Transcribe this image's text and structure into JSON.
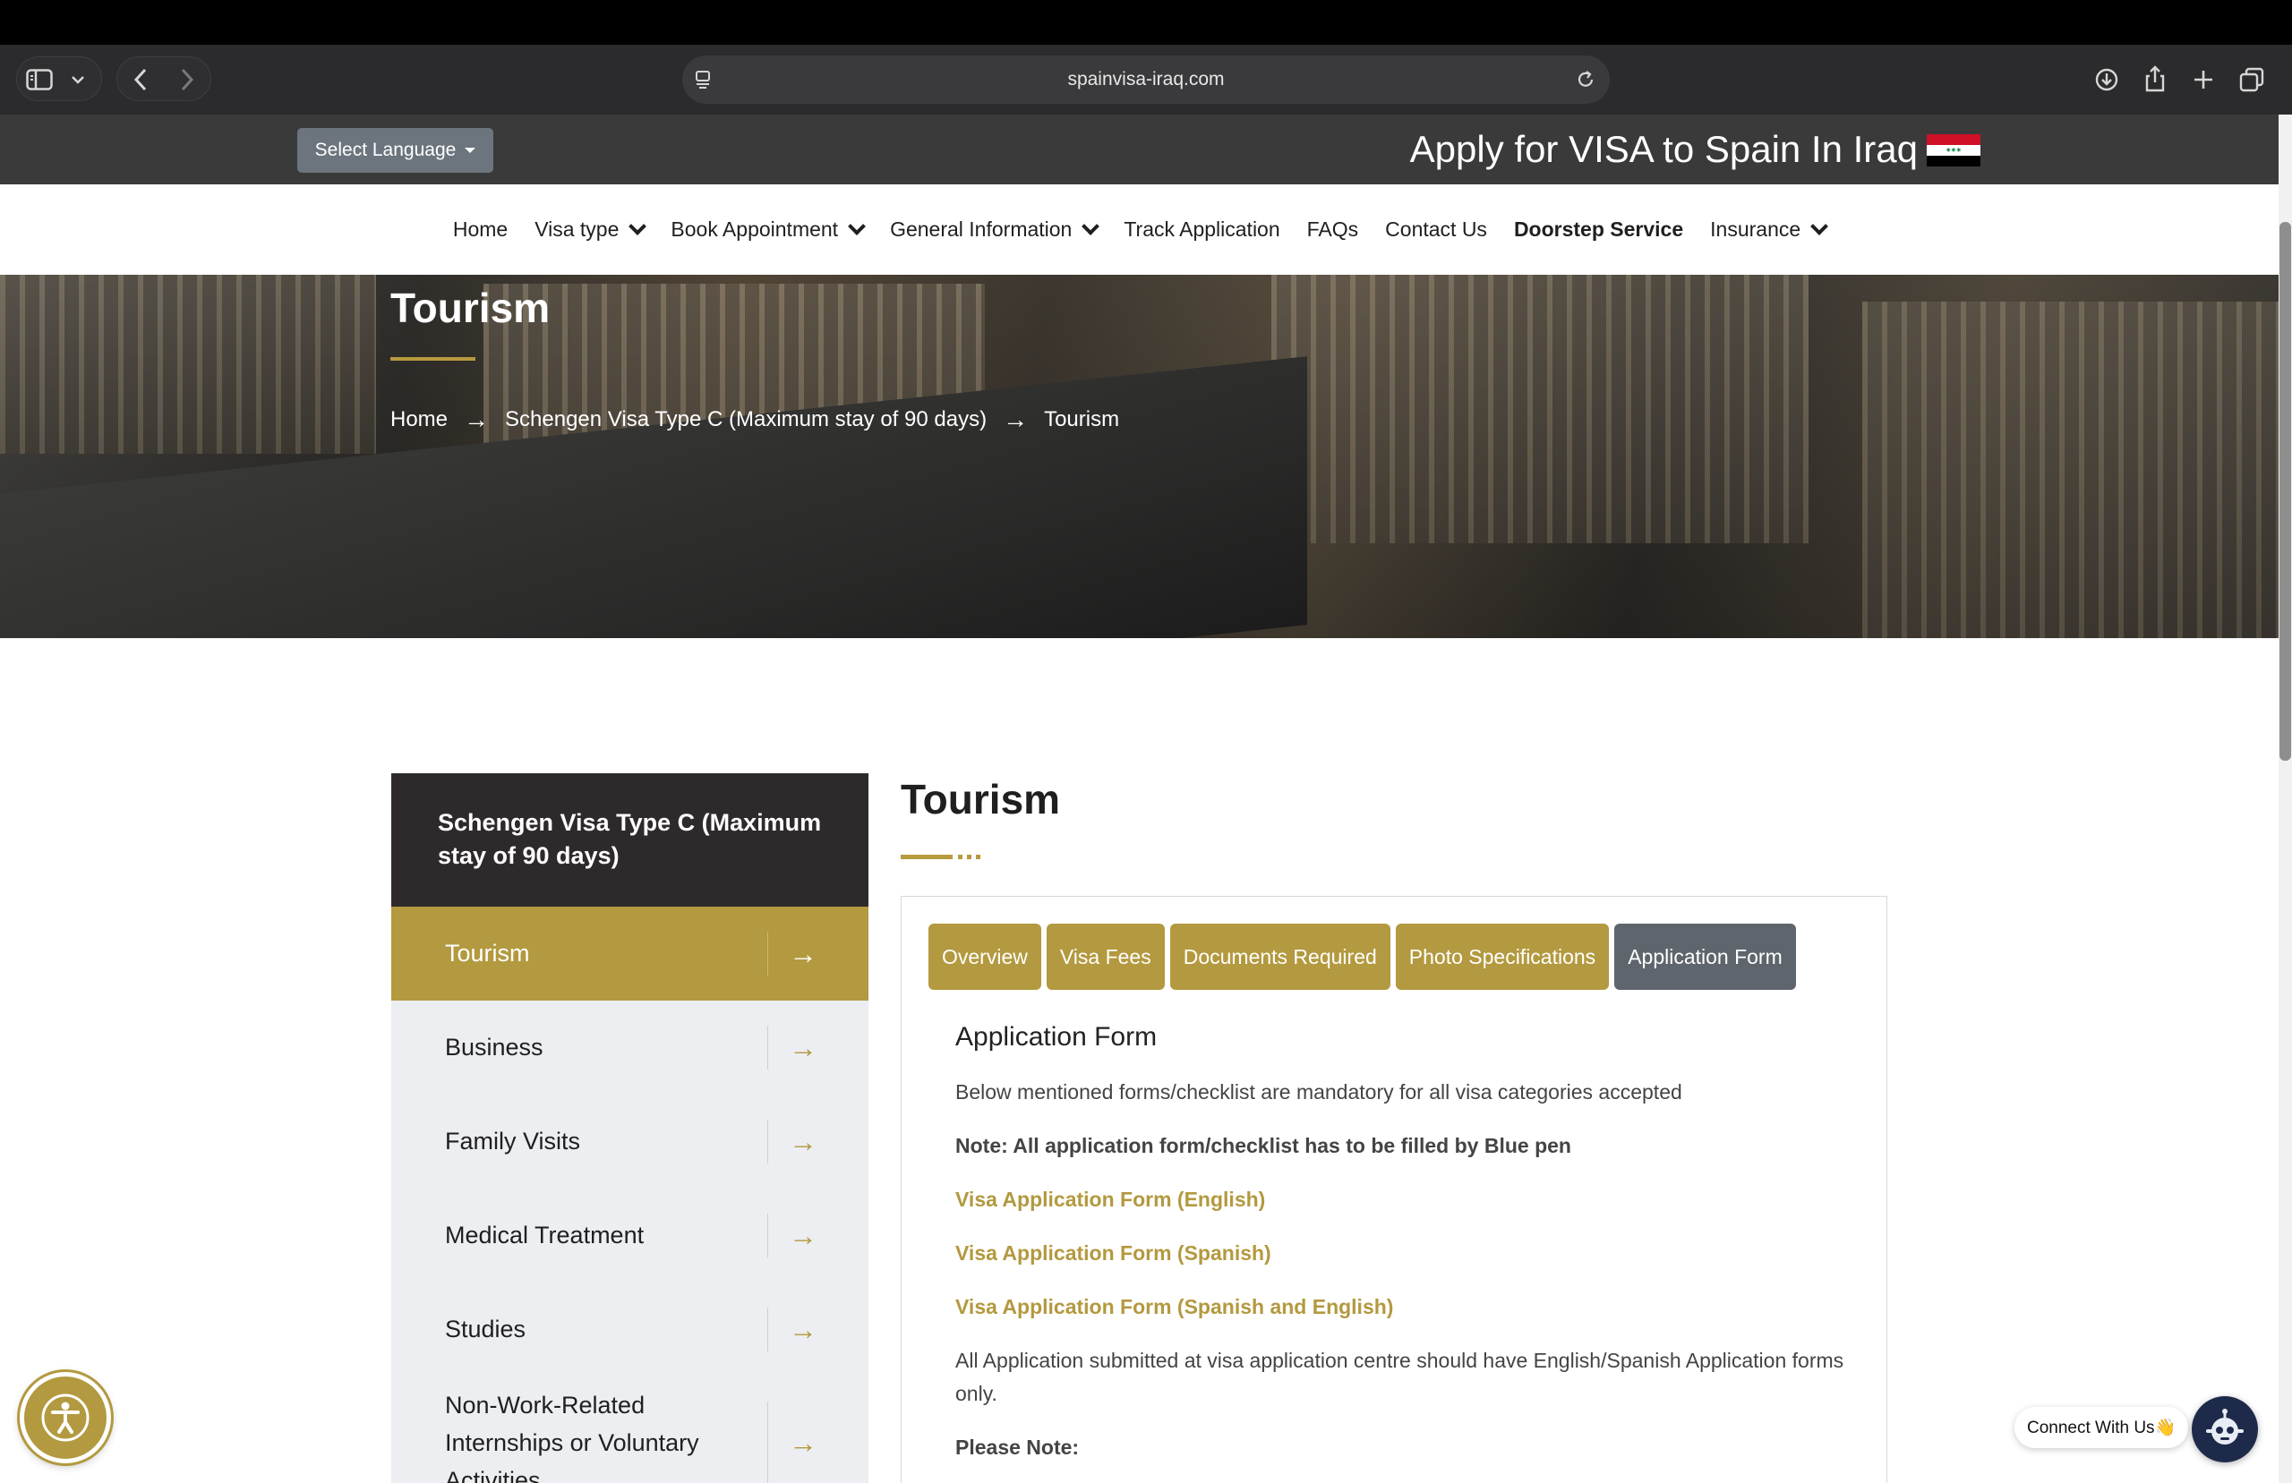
{
  "browser": {
    "url": "spainvisa-iraq.com"
  },
  "topbar": {
    "language_button": "Select Language",
    "apply_title": "Apply for VISA to Spain In Iraq"
  },
  "nav": {
    "items": [
      {
        "label": "Home"
      },
      {
        "label": "Visa type"
      },
      {
        "label": "Book Appointment"
      },
      {
        "label": "General Information"
      },
      {
        "label": "Track Application"
      },
      {
        "label": "FAQs"
      },
      {
        "label": "Contact Us"
      },
      {
        "label": "Doorstep Service"
      },
      {
        "label": "Insurance"
      }
    ]
  },
  "hero": {
    "title": "Tourism",
    "breadcrumb": [
      "Home",
      "Schengen Visa Type C (Maximum stay of 90 days)",
      "Tourism"
    ],
    "separator": "→"
  },
  "sidebar": {
    "heading": "Schengen Visa Type C (Maximum stay of 90 days)",
    "items": [
      {
        "label": "Tourism",
        "active": true
      },
      {
        "label": "Business"
      },
      {
        "label": "Family Visits"
      },
      {
        "label": "Medical Treatment"
      },
      {
        "label": "Studies"
      },
      {
        "label": "Non-Work-Related Internships or Voluntary Activities"
      }
    ],
    "arrow": "→"
  },
  "content": {
    "title": "Tourism",
    "tabs": [
      {
        "label": "Overview"
      },
      {
        "label": "Visa Fees"
      },
      {
        "label": "Documents Required"
      },
      {
        "label": "Photo Specifications"
      },
      {
        "label": "Application Form",
        "active": true
      }
    ],
    "form_heading": "Application Form",
    "intro": "Below mentioned forms/checklist are mandatory for all visa categories accepted",
    "note": "Note: All application form/checklist has to be filled by Blue pen",
    "links": [
      "Visa Application Form (English)",
      "Visa Application Form (Spanish)",
      "Visa Application Form (Spanish and English)"
    ],
    "submission_text": "All Application submitted at visa application centre should have English/Spanish Application forms only.",
    "please_note": "Please Note:"
  },
  "widgets": {
    "connect_label": "Connect With Us👋"
  },
  "colors": {
    "accent_gold": "#b3993f",
    "topbar_dark": "#3a3a3a",
    "sidebar_head": "#2e2a2b",
    "tab_active": "#5f656c"
  },
  "icons": [
    "sidebar-toggle-icon",
    "chevron-down-icon",
    "back-icon",
    "forward-icon",
    "reader-icon",
    "reload-icon",
    "download-icon",
    "share-icon",
    "new-tab-icon",
    "tabs-overview-icon",
    "iraq-flag-icon",
    "accessibility-icon",
    "chatbot-icon"
  ]
}
